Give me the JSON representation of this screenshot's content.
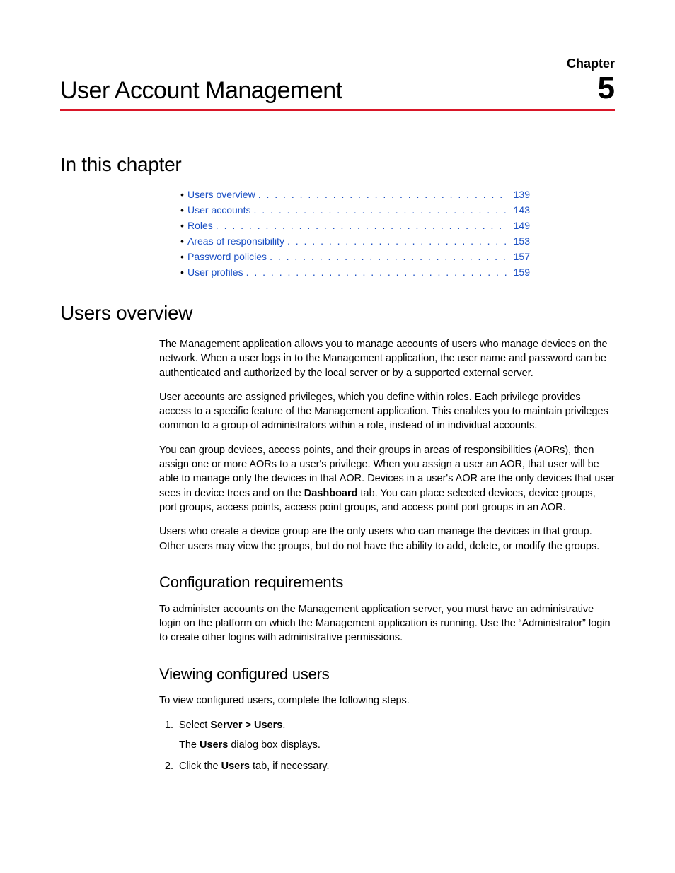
{
  "header": {
    "chapter_label": "Chapter",
    "chapter_number": "5",
    "chapter_title": "User Account Management"
  },
  "toc": {
    "heading": "In this chapter",
    "items": [
      {
        "label": "Users overview",
        "page": "139"
      },
      {
        "label": "User accounts",
        "page": "143"
      },
      {
        "label": "Roles",
        "page": "149"
      },
      {
        "label": "Areas of responsibility",
        "page": "153"
      },
      {
        "label": "Password policies",
        "page": "157"
      },
      {
        "label": "User profiles",
        "page": "159"
      }
    ]
  },
  "overview": {
    "heading": "Users overview",
    "p1": "The Management application allows you to manage accounts of users who manage devices on the network. When a user logs in to the Management application, the user name and password can be authenticated and authorized by the local server or by a supported external server.",
    "p2": "User accounts are assigned privileges, which you define within roles. Each privilege provides access to a specific feature of the Management application. This enables you to maintain privileges common to a group of administrators within a role, instead of in individual accounts.",
    "p3a": "You can group devices, access points, and their groups in areas of responsibilities (AORs), then assign one or more AORs to a user's privilege. When you assign a user an AOR, that user will be able to manage only the devices in that AOR. Devices in a user's AOR are the only devices that user sees in device trees and on the ",
    "p3_bold": "Dashboard",
    "p3b": " tab. You can place selected devices, device groups, port groups, access points, access point groups, and access point port groups in an AOR.",
    "p4": "Users who create a device group are the only users who can manage the devices in that group. Other users may view the groups, but do not have the ability to add, delete, or modify the groups."
  },
  "config": {
    "heading": "Configuration requirements",
    "p1": "To administer accounts on the Management application server, you must have an administrative login on the platform on which the Management application is running. Use the “Administrator” login to create other logins with administrative permissions."
  },
  "viewing": {
    "heading": "Viewing configured users",
    "intro": "To view configured users, complete the following steps.",
    "step1_a": "Select ",
    "step1_bold": "Server > Users",
    "step1_b": ".",
    "step1_sub_a": "The ",
    "step1_sub_bold": "Users",
    "step1_sub_b": " dialog box displays.",
    "step2_a": "Click the ",
    "step2_bold": "Users",
    "step2_b": " tab, if necessary."
  }
}
